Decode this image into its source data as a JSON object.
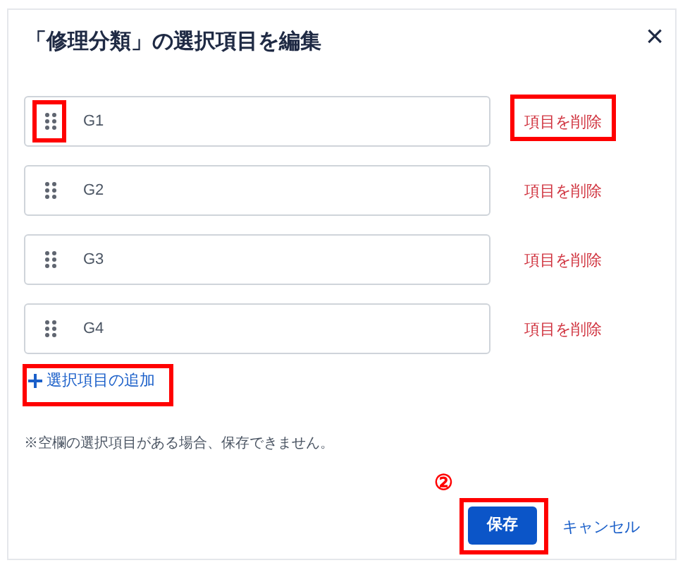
{
  "dialog": {
    "title": "「修理分類」の選択項目を編集",
    "close": "×"
  },
  "options": [
    {
      "value": "G1",
      "delete_label": "項目を削除",
      "handle_highlighted": true,
      "delete_highlighted": true
    },
    {
      "value": "G2",
      "delete_label": "項目を削除",
      "handle_highlighted": false,
      "delete_highlighted": false
    },
    {
      "value": "G3",
      "delete_label": "項目を削除",
      "handle_highlighted": false,
      "delete_highlighted": false
    },
    {
      "value": "G4",
      "delete_label": "項目を削除",
      "handle_highlighted": false,
      "delete_highlighted": false
    }
  ],
  "add_link": {
    "label": "選択項目の追加",
    "highlighted": true
  },
  "note": "※空欄の選択項目がある場合、保存できません。",
  "step_marker": "②",
  "footer": {
    "save": "保存",
    "save_highlighted": true,
    "cancel": "キャンセル"
  }
}
